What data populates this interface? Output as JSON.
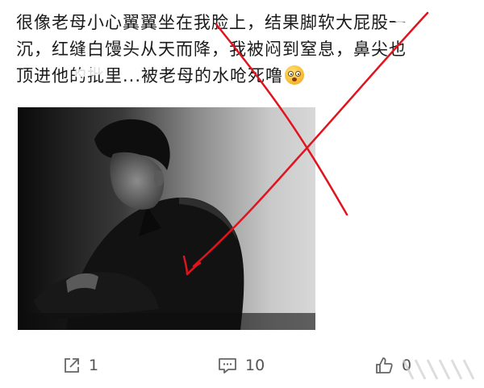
{
  "post": {
    "lines": [
      "很像老母小心翼翼坐在我脸上，结果脚软大屁股一",
      "沉，红缝白馒头从天而降，我被闷到窒息，鼻尖也",
      "顶进他的批里...被老母的水呛死噜"
    ],
    "emoji": "flushed-face-emoji"
  },
  "photo": {
    "description_icon": "black-and-white-portrait-photo"
  },
  "actions": {
    "share_count": "1",
    "comment_count": "10",
    "like_count": "0"
  },
  "watermark": "",
  "colors": {
    "text": "#1a1a1a",
    "action_text": "#555555",
    "annotation_red": "#e0141e"
  }
}
